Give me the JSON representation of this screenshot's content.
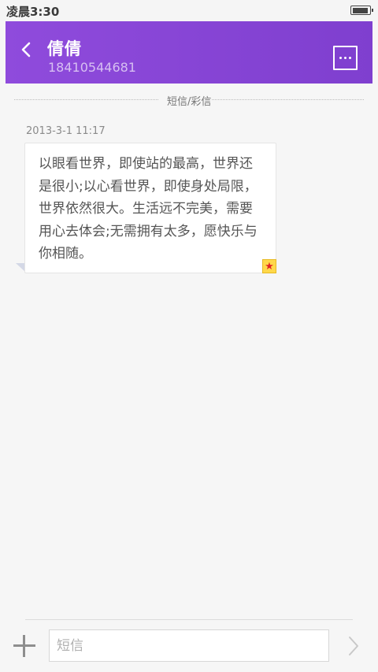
{
  "status_bar": {
    "time": "凌晨3:30",
    "battery_level": 0.95
  },
  "header": {
    "contact_name": "倩倩",
    "contact_number": "18410544681",
    "back_icon": "chevron-left-icon",
    "more_icon": "more-dots-icon"
  },
  "conversation": {
    "channel_label": "短信/彩信",
    "messages": [
      {
        "timestamp": "2013-3-1 11:17",
        "text": "以眼看世界，即使站的最高，世界还是很小;以心看世界，即使身处局限，世界依然很大。生活远不完美，需要用心去体会;无需拥有太多，愿快乐与你相随。",
        "starred": true,
        "star_icon": "star-icon"
      }
    ]
  },
  "compose": {
    "placeholder": "短信",
    "value": "",
    "add_icon": "plus-icon",
    "send_icon": "chevron-right-icon"
  },
  "colors": {
    "header_bg": "#8a46d8",
    "star_badge": "#ffd84a",
    "star": "#e02424"
  }
}
